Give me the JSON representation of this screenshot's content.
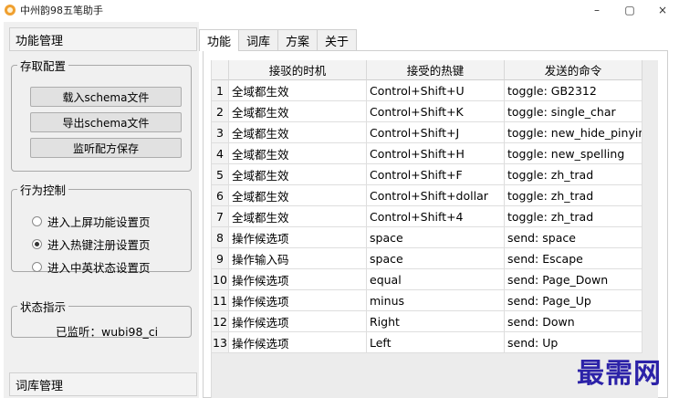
{
  "window": {
    "title": "中州韵98五笔助手",
    "controls": {
      "minimize": "–",
      "maximize": "▢",
      "close": "×"
    }
  },
  "left": {
    "header": "功能管理",
    "config_group": {
      "legend": "存取配置",
      "buttons": [
        "载入schema文件",
        "导出schema文件",
        "监听配方保存"
      ]
    },
    "behavior_group": {
      "legend": "行为控制",
      "options": [
        {
          "label": "进入上屏功能设置页",
          "checked": false
        },
        {
          "label": "进入热键注册设置页",
          "checked": true
        },
        {
          "label": "进入中英状态设置页",
          "checked": false
        }
      ]
    },
    "status_group": {
      "legend": "状态指示",
      "text": "已监听：wubi98_ci"
    },
    "dict_header": "词库管理"
  },
  "tabs": [
    {
      "label": "功能",
      "active": true
    },
    {
      "label": "词库",
      "active": false
    },
    {
      "label": "方案",
      "active": false
    },
    {
      "label": "关于",
      "active": false
    }
  ],
  "table": {
    "columns": [
      "",
      "接驳的时机",
      "接受的热键",
      "发送的命令"
    ],
    "rows": [
      [
        "1",
        "全域都生效",
        "Control+Shift+U",
        "toggle: GB2312"
      ],
      [
        "2",
        "全域都生效",
        "Control+Shift+K",
        "toggle: single_char"
      ],
      [
        "3",
        "全域都生效",
        "Control+Shift+J",
        "toggle: new_hide_pinyin"
      ],
      [
        "4",
        "全域都生效",
        "Control+Shift+H",
        "toggle: new_spelling"
      ],
      [
        "5",
        "全域都生效",
        "Control+Shift+F",
        "toggle: zh_trad"
      ],
      [
        "6",
        "全域都生效",
        "Control+Shift+dollar",
        "toggle: zh_trad"
      ],
      [
        "7",
        "全域都生效",
        "Control+Shift+4",
        "toggle: zh_trad"
      ],
      [
        "8",
        "操作候选项",
        "space",
        "send: space"
      ],
      [
        "9",
        "操作输入码",
        "space",
        "send: Escape"
      ],
      [
        "10",
        "操作候选项",
        "equal",
        "send: Page_Down"
      ],
      [
        "11",
        "操作候选项",
        "minus",
        "send: Page_Up"
      ],
      [
        "12",
        "操作候选项",
        "Right",
        "send: Down"
      ],
      [
        "13",
        "操作候选项",
        "Left",
        "send: Up"
      ]
    ]
  },
  "watermark": "最需网",
  "colors": {
    "watermark": "#2c22a8",
    "app_icon": "#f0a030"
  }
}
